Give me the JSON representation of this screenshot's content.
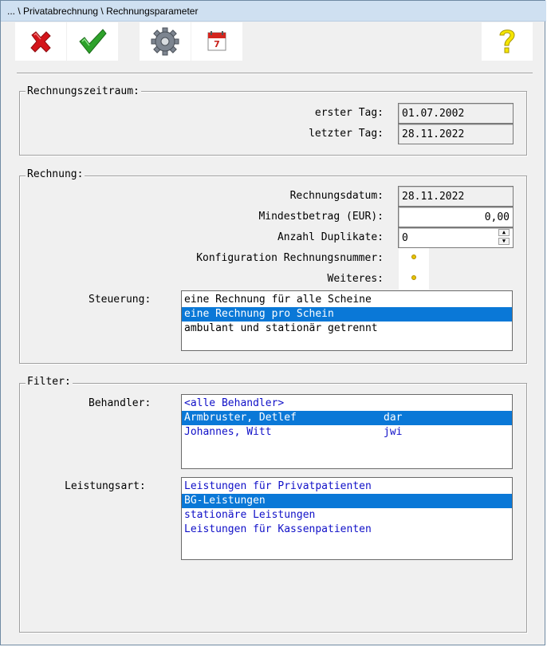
{
  "window": {
    "title": "... \\ Privatabrechnung \\ Rechnungsparameter"
  },
  "toolbar": {
    "buttons": [
      {
        "name": "cancel",
        "icon": "red-x-icon"
      },
      {
        "name": "ok",
        "icon": "green-check-icon"
      },
      {
        "name": "settings",
        "icon": "gear-icon"
      },
      {
        "name": "calendar",
        "icon": "calendar-icon",
        "text": "7"
      },
      {
        "name": "help",
        "icon": "question-mark-icon"
      }
    ]
  },
  "rechnungszeitraum": {
    "legend": "Rechnungszeitraum:",
    "erster_tag_label": "erster Tag:",
    "erster_tag_value": "01.07.2002",
    "letzter_tag_label": "letzter Tag:",
    "letzter_tag_value": "28.11.2022"
  },
  "rechnung": {
    "legend": "Rechnung:",
    "datum_label": "Rechnungsdatum:",
    "datum_value": "28.11.2022",
    "mindest_label": "Mindestbetrag (EUR):",
    "mindest_value": "0,00",
    "duplikate_label": "Anzahl Duplikate:",
    "duplikate_value": "0",
    "konfig_label": "Konfiguration Rechnungsnummer:",
    "weiteres_label": "Weiteres:",
    "steuerung_label": "Steuerung:",
    "steuerung_items": [
      "eine Rechnung für alle Scheine",
      "eine Rechnung pro Schein",
      "ambulant und stationär getrennt"
    ],
    "steuerung_selected": 1
  },
  "filter": {
    "legend": "Filter:",
    "behandler_label": "Behandler:",
    "behandler_items": [
      {
        "name": "<alle Behandler>",
        "code": ""
      },
      {
        "name": "Armbruster, Detlef",
        "code": "dar"
      },
      {
        "name": "Johannes, Witt",
        "code": "jwi"
      }
    ],
    "behandler_selected": 1,
    "leistungsart_label": "Leistungsart:",
    "leistungsart_items": [
      "Leistungen für Privatpatienten",
      "BG-Leistungen",
      "stationäre Leistungen",
      "Leistungen für Kassenpatienten"
    ],
    "leistungsart_selected": 1
  },
  "colors": {
    "selection": "#0a78d7",
    "list_text_blue": "#1010c8",
    "titlebar": "#cfe0f1"
  }
}
